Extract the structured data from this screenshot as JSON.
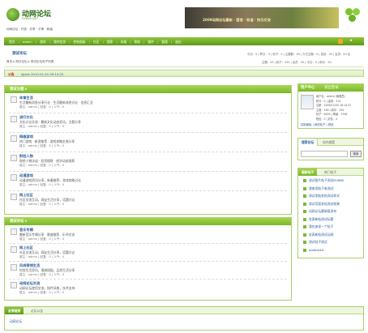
{
  "brand": {
    "name": "动网论坛",
    "sub": "DVBBS.NET",
    "slogan": "动网论坛 · 开放 · 共享 · 平等 · 和谐"
  },
  "banner": {
    "text": "2009动网论坛最新 · 营造 · 和谐 · 快乐交流"
  },
  "topnav": {
    "items": [
      "首页",
      "admin",
      "我的",
      "我的信息",
      "控制面板",
      "社区",
      "搜索",
      "风格",
      "帮助",
      "插件",
      "管理",
      "退出"
    ]
  },
  "topnav_right": "★",
  "forum_title": "测试论坛",
  "forum_stats_line": "今日：0 | 昨日：0 | 帖子：0 | 主题数：40 | 今日主题：0 | 发帖：40 | 会员：43 名",
  "breadcrumb": "首页 ▸ 测试论坛 ▸ 测试论坛帖子列表",
  "stats_right": "主题：43 | 帖子：205 | 会员：55 | 今日：0 | 积分：20",
  "notice_label": "公告",
  "notice_text": "xjjavs    2010-01-01 09:14:22",
  "section1": {
    "title": "测试主题 ▸",
    "posts": [
      {
        "title": "体育生活",
        "desc": "生活最新消息分享行业 · 生活最新消息讨论 · 信息汇总",
        "meta": "楼主：admin | 回复：0 | 人气：0"
      },
      {
        "title": "流行文化",
        "desc": "文化讨论交流 · 最新文化动态资讯，主题分享",
        "meta": "楼主：admin | 回复：0 | 人气：0"
      },
      {
        "title": "网络游戏",
        "desc": "热门游戏 · 新游推荐 · 游戏攻略交流分享",
        "meta": "楼主：admin | 回复：0 | 人气：0"
      },
      {
        "title": "财经人物",
        "desc": "财经人物访谈 · 投资理财 · 经济动态观察",
        "meta": "楼主：admin | 回复：0 | 人气：0"
      },
      {
        "title": "动漫游戏",
        "desc": "动漫游戏资讯分享，新番推荐，游戏攻略讨论",
        "meta": "楼主：admin | 回复：0 | 人气：0"
      },
      {
        "title": "网上社区",
        "desc": "社区交流互动，网友生活分享，话题讨论",
        "meta": "楼主：admin | 回复：0 | 人气：0"
      }
    ]
  },
  "section2": {
    "title": "测试论坛 ▸",
    "posts": [
      {
        "title": "音乐专辑",
        "desc": "最新音乐专辑分享 · 歌曲推荐 · 乐评交流",
        "meta": "楼主：admin | 回复：0 | 人气：0"
      },
      {
        "title": "网上社区",
        "desc": "社区交流互动，网友生活分享，话题讨论",
        "meta": "楼主：admin | 回复：0 | 人气：0"
      },
      {
        "title": "风尚带领生活",
        "desc": "时尚生活资讯，潮流搭配，品质生活分享",
        "meta": "楼主：admin | 回复：0 | 人气：0"
      },
      {
        "title": "动网论坛交流",
        "desc": "动网论坛使用交流，插件风格，技术支持",
        "meta": "楼主：admin | 回复：0 | 人气：0"
      }
    ]
  },
  "user_panel": {
    "title": "用户中心",
    "login": "退出登录",
    "lines": [
      "用户名：admin (管理员)",
      "积分：0 | 金钱：374",
      "注册：2009/12/30 16:14:22",
      "主题：160 | 精华：255",
      "帖子：8000 | 等级：3746",
      "短信：0 | 好友：0"
    ],
    "links": "控制面板 | 我的帖子 | 短信"
  },
  "search_panel": {
    "title": "搜索论坛",
    "tab2": "站内搜索",
    "placeholder": "",
    "button": "搜索"
  },
  "hot_panel": {
    "title": "最新帖子",
    "tab2": "热门帖子",
    "items": [
      "测试图片帖子测试DVBBS",
      "我来发贴子来测试",
      "测试发贴发帖测试样式",
      "测试页面发帖测试效果",
      "动网论坛最新版发布",
      "发表新帖测试标题",
      "我也来发一个帖子",
      "发表新帖测试动网",
      "测试帖子测试",
      "aodkdskd"
    ]
  },
  "bottom_tabs": {
    "active": "友情链接",
    "other": "论坛公告"
  },
  "friend_link": "动网论坛"
}
